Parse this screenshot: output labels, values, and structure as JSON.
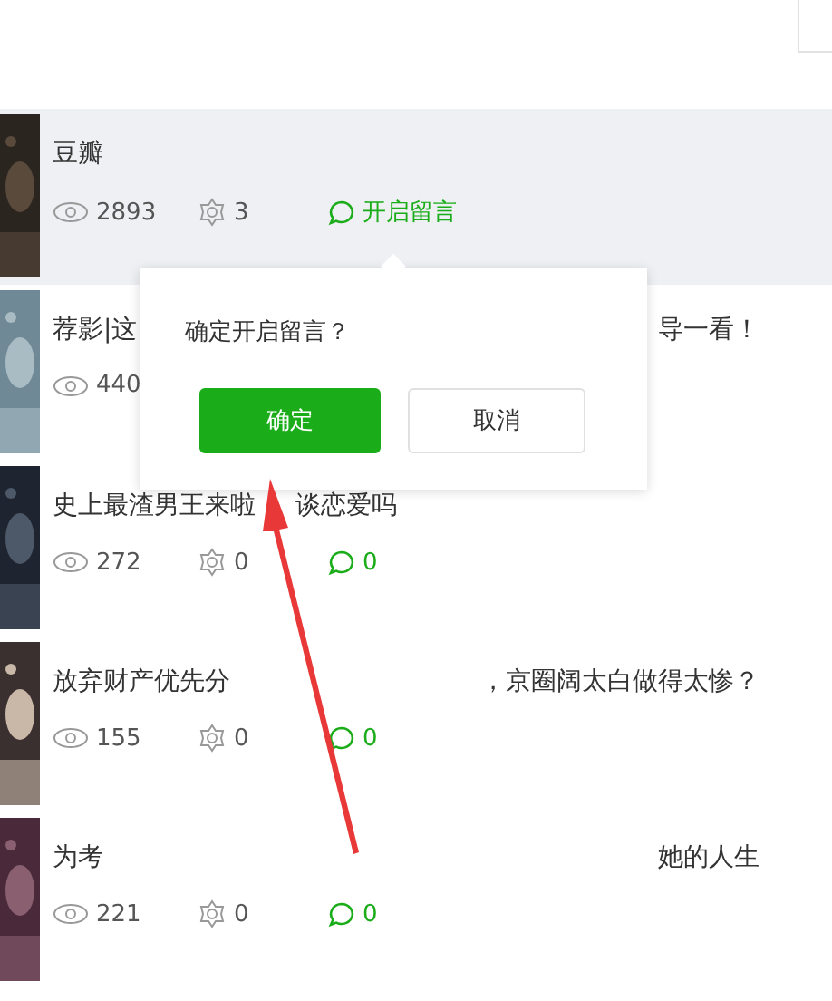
{
  "articles": [
    {
      "title": "豆瓣",
      "highlighted": true,
      "views": "2893",
      "likes": "3",
      "comments": "开启留言"
    },
    {
      "title": "荐影|这",
      "title_tail": "导一看！",
      "highlighted": false,
      "views": "440"
    },
    {
      "title": "史上最渣男王来啦",
      "title_cont": "谈恋爱吗",
      "highlighted": false,
      "views": "272",
      "likes": "0",
      "comments": "0"
    },
    {
      "title": "放弃财产优先分",
      "title_tail": "，京圈阔太白做得太惨？",
      "highlighted": false,
      "views": "155",
      "likes": "0",
      "comments": "0"
    },
    {
      "title": "为考",
      "title_tail": "她的人生",
      "highlighted": false,
      "views": "221",
      "likes": "0",
      "comments": "0"
    }
  ],
  "popover": {
    "message": "确定开启留言？",
    "confirm": "确定",
    "cancel": "取消"
  }
}
